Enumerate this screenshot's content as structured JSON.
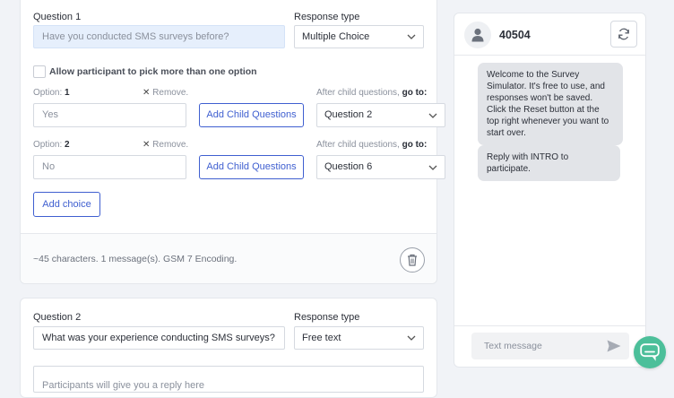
{
  "question1": {
    "label": "Question 1",
    "placeholder": "Have you conducted SMS surveys before?",
    "response_type_label": "Response type",
    "response_type": "Multiple Choice",
    "allow_multiple_label": "Allow participant to pick more than one option",
    "options": [
      {
        "label_prefix": "Option:",
        "number": "1",
        "remove_label": "Remove.",
        "value_placeholder": "Yes",
        "add_child_label": "Add Child Questions",
        "after_label_prefix": "After child questions,",
        "after_label_go": "go to:",
        "goto_value": "Question 2"
      },
      {
        "label_prefix": "Option:",
        "number": "2",
        "remove_label": "Remove.",
        "value_placeholder": "No",
        "add_child_label": "Add Child Questions",
        "after_label_prefix": "After child questions,",
        "after_label_go": "go to:",
        "goto_value": "Question 6"
      }
    ],
    "add_choice_label": "Add choice",
    "footer_info": "~45 characters. 1 message(s). GSM 7 Encoding."
  },
  "question2": {
    "label": "Question 2",
    "value": "What was your experience conducting SMS surveys?",
    "response_type_label": "Response type",
    "response_type": "Free text",
    "partial_text": "Participants will give you a reply here"
  },
  "simulator": {
    "number": "40504",
    "messages": [
      "Welcome to the Survey Simulator. It's free to use, and responses won't be saved. Click the Reset button at the top right whenever you want to start over.",
      "Reply with INTRO to participate."
    ],
    "input_placeholder": "Text message"
  },
  "colors": {
    "accent": "#3f5fd0",
    "chat_fab": "#4cbf9a",
    "bubble": "#e2e4e8"
  }
}
